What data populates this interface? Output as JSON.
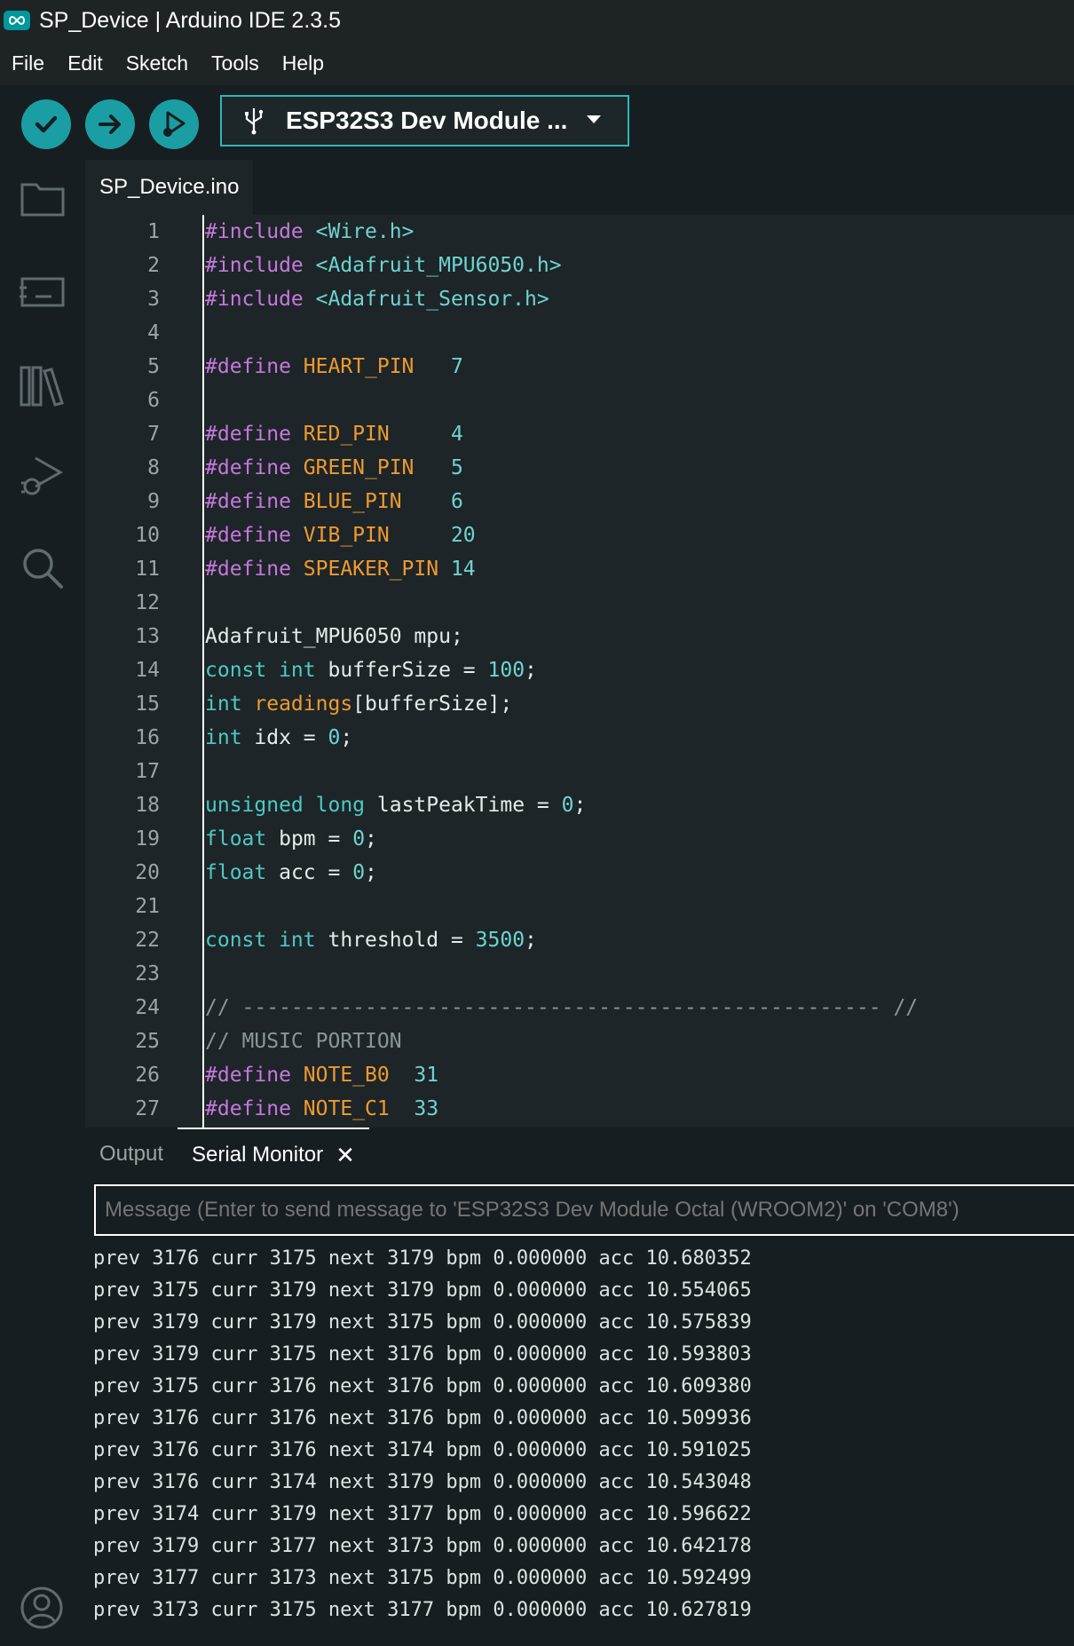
{
  "window": {
    "title": "SP_Device | Arduino IDE 2.3.5"
  },
  "menu": {
    "items": [
      "File",
      "Edit",
      "Sketch",
      "Tools",
      "Help"
    ]
  },
  "toolbar": {
    "verify_icon": "checkmark-icon",
    "upload_icon": "arrow-right-icon",
    "debug_icon": "debug-icon",
    "board": "ESP32S3 Dev Module ..."
  },
  "sidebar": {
    "icons": [
      "folder-icon",
      "board-manager-icon",
      "library-icon",
      "debug-icon",
      "search-icon",
      "account-icon"
    ]
  },
  "editor": {
    "tab": "SP_Device.ino",
    "lines": [
      [
        [
          "kw-pre",
          "#include "
        ],
        [
          "str",
          "<Wire.h>"
        ]
      ],
      [
        [
          "kw-pre",
          "#include "
        ],
        [
          "str",
          "<Adafruit_MPU6050.h>"
        ]
      ],
      [
        [
          "kw-pre",
          "#include "
        ],
        [
          "str",
          "<Adafruit_Sensor.h>"
        ]
      ],
      [],
      [
        [
          "kw-pre",
          "#define "
        ],
        [
          "const",
          "HEART_PIN   "
        ],
        [
          "num",
          "7"
        ]
      ],
      [],
      [
        [
          "kw-pre",
          "#define "
        ],
        [
          "const",
          "RED_PIN     "
        ],
        [
          "num",
          "4"
        ]
      ],
      [
        [
          "kw-pre",
          "#define "
        ],
        [
          "const",
          "GREEN_PIN   "
        ],
        [
          "num",
          "5"
        ]
      ],
      [
        [
          "kw-pre",
          "#define "
        ],
        [
          "const",
          "BLUE_PIN    "
        ],
        [
          "num",
          "6"
        ]
      ],
      [
        [
          "kw-pre",
          "#define "
        ],
        [
          "const",
          "VIB_PIN     "
        ],
        [
          "num",
          "20"
        ]
      ],
      [
        [
          "kw-pre",
          "#define "
        ],
        [
          "const",
          "SPEAKER_PIN "
        ],
        [
          "num",
          "14"
        ]
      ],
      [],
      [
        [
          "",
          "Adafruit_MPU6050 mpu;"
        ]
      ],
      [
        [
          "kw",
          "const int "
        ],
        [
          "",
          "bufferSize = "
        ],
        [
          "num",
          "100"
        ],
        [
          "",
          ";"
        ]
      ],
      [
        [
          "kw",
          "int "
        ],
        [
          "fn",
          "readings"
        ],
        [
          "",
          "[bufferSize];"
        ]
      ],
      [
        [
          "kw",
          "int "
        ],
        [
          "",
          "idx = "
        ],
        [
          "num",
          "0"
        ],
        [
          "",
          ";"
        ]
      ],
      [],
      [
        [
          "kw",
          "unsigned long "
        ],
        [
          "",
          "lastPeakTime = "
        ],
        [
          "num",
          "0"
        ],
        [
          "",
          ";"
        ]
      ],
      [
        [
          "kw",
          "float "
        ],
        [
          "",
          "bpm = "
        ],
        [
          "num",
          "0"
        ],
        [
          "",
          ";"
        ]
      ],
      [
        [
          "kw",
          "float "
        ],
        [
          "",
          "acc = "
        ],
        [
          "num",
          "0"
        ],
        [
          "",
          ";"
        ]
      ],
      [],
      [
        [
          "kw",
          "const int "
        ],
        [
          "",
          "threshold = "
        ],
        [
          "num",
          "3500"
        ],
        [
          "",
          ";"
        ]
      ],
      [],
      [
        [
          "cm",
          "// ---------------------------------------------------- //"
        ]
      ],
      [
        [
          "cm",
          "// MUSIC PORTION"
        ]
      ],
      [
        [
          "kw-pre",
          "#define "
        ],
        [
          "const",
          "NOTE_B0  "
        ],
        [
          "num",
          "31"
        ]
      ],
      [
        [
          "kw-pre",
          "#define "
        ],
        [
          "const",
          "NOTE_C1  "
        ],
        [
          "num",
          "33"
        ]
      ]
    ]
  },
  "panel": {
    "tabs": {
      "output": "Output",
      "serial": "Serial Monitor",
      "close": "✕"
    },
    "input_placeholder": "Message (Enter to send message to 'ESP32S3 Dev Module Octal (WROOM2)' on 'COM8')",
    "serial_lines": [
      "prev 3176 curr 3175 next 3179 bpm 0.000000 acc 10.680352",
      "prev 3175 curr 3179 next 3179 bpm 0.000000 acc 10.554065",
      "prev 3179 curr 3179 next 3175 bpm 0.000000 acc 10.575839",
      "prev 3179 curr 3175 next 3176 bpm 0.000000 acc 10.593803",
      "prev 3175 curr 3176 next 3176 bpm 0.000000 acc 10.609380",
      "prev 3176 curr 3176 next 3176 bpm 0.000000 acc 10.509936",
      "prev 3176 curr 3176 next 3174 bpm 0.000000 acc 10.591025",
      "prev 3176 curr 3174 next 3179 bpm 0.000000 acc 10.543048",
      "prev 3174 curr 3179 next 3177 bpm 0.000000 acc 10.596622",
      "prev 3179 curr 3177 next 3173 bpm 0.000000 acc 10.642178",
      "prev 3177 curr 3173 next 3175 bpm 0.000000 acc 10.592499",
      "prev 3173 curr 3175 next 3177 bpm 0.000000 acc 10.627819"
    ]
  },
  "colors": {
    "accent": "#1a9ea3",
    "background": "#171e21",
    "editor": "#1d2528"
  }
}
